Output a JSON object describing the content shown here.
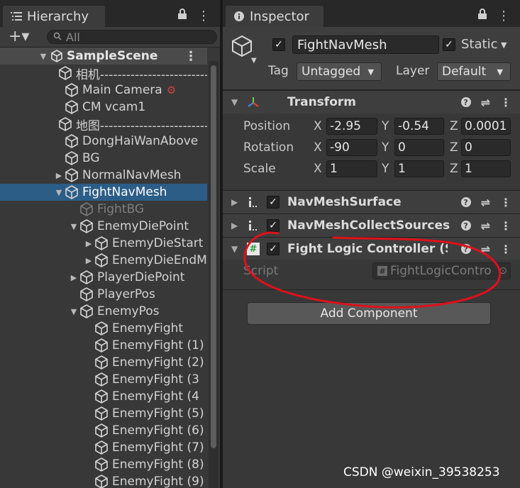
{
  "hierarchy": {
    "tab_label": "Hierarchy",
    "add_label": "+▾",
    "search_placeholder": "All",
    "scene_name": "SampleScene",
    "items": [
      {
        "label": "相机----------------------------",
        "depth": 1,
        "expander": "none",
        "style": "normal"
      },
      {
        "label": "Main Camera",
        "depth": 1,
        "expander": "none",
        "style": "normal",
        "badge": "gear"
      },
      {
        "label": "CM vcam1",
        "depth": 1,
        "expander": "none",
        "style": "normal"
      },
      {
        "label": "地图----------------------------",
        "depth": 1,
        "expander": "none",
        "style": "normal"
      },
      {
        "label": "DongHaiWanAbove",
        "depth": 1,
        "expander": "none",
        "style": "normal"
      },
      {
        "label": "BG",
        "depth": 1,
        "expander": "none",
        "style": "normal"
      },
      {
        "label": "NormalNavMesh",
        "depth": 1,
        "expander": "collapsed",
        "style": "normal"
      },
      {
        "label": "FightNavMesh",
        "depth": 1,
        "expander": "expanded",
        "style": "selected"
      },
      {
        "label": "FightBG",
        "depth": 2,
        "expander": "none",
        "style": "disabled"
      },
      {
        "label": "EnemyDiePoint",
        "depth": 2,
        "expander": "expanded",
        "style": "normal"
      },
      {
        "label": "EnemyDieStart",
        "depth": 3,
        "expander": "collapsed",
        "style": "normal"
      },
      {
        "label": "EnemyDieEndM",
        "depth": 3,
        "expander": "collapsed",
        "style": "normal"
      },
      {
        "label": "PlayerDiePoint",
        "depth": 2,
        "expander": "collapsed",
        "style": "normal"
      },
      {
        "label": "PlayerPos",
        "depth": 2,
        "expander": "none",
        "style": "normal"
      },
      {
        "label": "EnemyPos",
        "depth": 2,
        "expander": "expanded",
        "style": "normal"
      },
      {
        "label": "EnemyFight",
        "depth": 3,
        "expander": "none",
        "style": "normal"
      },
      {
        "label": "EnemyFight (1)",
        "depth": 3,
        "expander": "none",
        "style": "normal"
      },
      {
        "label": "EnemyFight (2)",
        "depth": 3,
        "expander": "none",
        "style": "normal"
      },
      {
        "label": "EnemyFight (3",
        "depth": 3,
        "expander": "none",
        "style": "normal"
      },
      {
        "label": "EnemyFight (4",
        "depth": 3,
        "expander": "none",
        "style": "normal"
      },
      {
        "label": "EnemyFight (5)",
        "depth": 3,
        "expander": "none",
        "style": "normal"
      },
      {
        "label": "EnemyFight (6)",
        "depth": 3,
        "expander": "none",
        "style": "normal"
      },
      {
        "label": "EnemyFight (7)",
        "depth": 3,
        "expander": "none",
        "style": "normal"
      },
      {
        "label": "EnemyFight (8)",
        "depth": 3,
        "expander": "none",
        "style": "normal"
      },
      {
        "label": "EnemyFight (9)",
        "depth": 3,
        "expander": "none",
        "style": "normal"
      }
    ]
  },
  "inspector": {
    "tab_label": "Inspector",
    "object_name": "FightNavMesh",
    "static_label": "Static",
    "tag_label": "Tag",
    "tag_value": "Untagged",
    "layer_label": "Layer",
    "layer_value": "Default",
    "transform": {
      "title": "Transform",
      "rows": [
        {
          "label": "Position",
          "x": "-2.95",
          "y": "-0.54",
          "z": "0.0001"
        },
        {
          "label": "Rotation",
          "x": "-90",
          "y": "0",
          "z": "0"
        },
        {
          "label": "Scale",
          "x": "1",
          "y": "1",
          "z": "1"
        }
      ],
      "axis_labels": [
        "X",
        "Y",
        "Z"
      ]
    },
    "components": [
      {
        "title": "NavMeshSurface",
        "icon": "navmesh-icon"
      },
      {
        "title": "NavMeshCollectSources",
        "icon": "navmesh-icon"
      },
      {
        "title": "Fight Logic Controller (S",
        "icon": "script-hash-icon"
      }
    ],
    "script_label": "Script",
    "script_value": "FightLogicContro",
    "add_component_label": "Add Component"
  },
  "watermark": "CSDN @weixin_39538253",
  "colors": {
    "selection": "#2c5d87",
    "annotation": "#e0101a",
    "panel": "#383838"
  }
}
